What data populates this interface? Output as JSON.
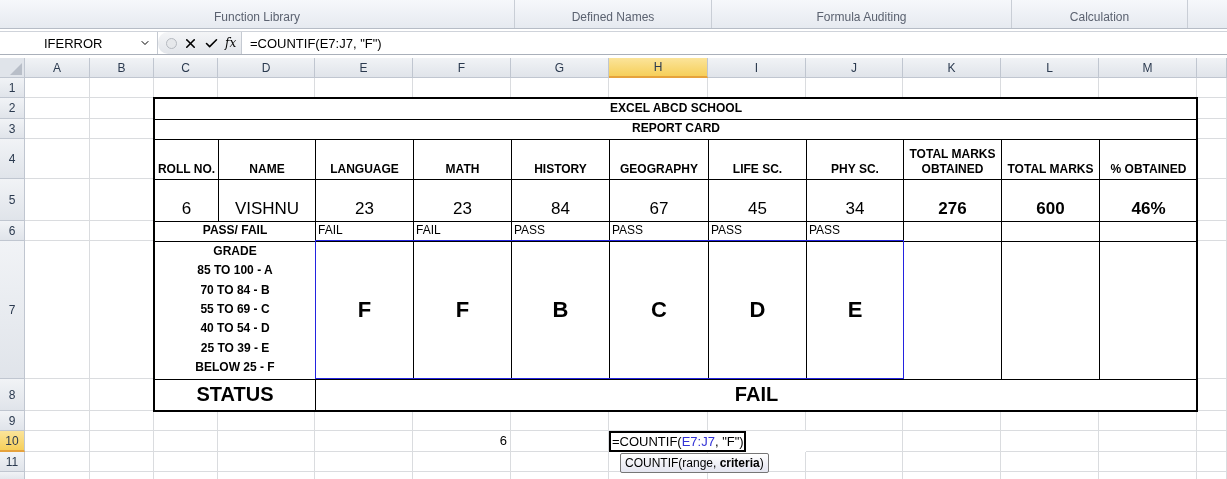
{
  "ribbon": {
    "groups": [
      {
        "label": "Function Library"
      },
      {
        "label": "Defined Names"
      },
      {
        "label": "Formula Auditing"
      },
      {
        "label": "Calculation"
      }
    ]
  },
  "formula_bar": {
    "name_box": "IFERROR",
    "fx": "fx",
    "formula": "=COUNTIF(E7:J7, \"F\")"
  },
  "columns": [
    {
      "label": "A",
      "selected": false
    },
    {
      "label": "B",
      "selected": false
    },
    {
      "label": "C",
      "selected": false
    },
    {
      "label": "D",
      "selected": false
    },
    {
      "label": "E",
      "selected": false
    },
    {
      "label": "F",
      "selected": false
    },
    {
      "label": "G",
      "selected": false
    },
    {
      "label": "H",
      "selected": true
    },
    {
      "label": "I",
      "selected": false
    },
    {
      "label": "J",
      "selected": false
    },
    {
      "label": "K",
      "selected": false
    },
    {
      "label": "L",
      "selected": false
    },
    {
      "label": "M",
      "selected": false
    }
  ],
  "rows": [
    {
      "label": "1",
      "selected": false
    },
    {
      "label": "2",
      "selected": false
    },
    {
      "label": "3",
      "selected": false
    },
    {
      "label": "4",
      "selected": false
    },
    {
      "label": "5",
      "selected": false
    },
    {
      "label": "6",
      "selected": false
    },
    {
      "label": "7",
      "selected": false
    },
    {
      "label": "8",
      "selected": false
    },
    {
      "label": "9",
      "selected": false
    },
    {
      "label": "10",
      "selected": true
    },
    {
      "label": "11",
      "selected": false
    }
  ],
  "report": {
    "title": "EXCEL ABCD SCHOOL",
    "subtitle": "REPORT CARD",
    "headers": [
      "ROLL NO.",
      "NAME",
      "LANGUAGE",
      "MATH",
      "HISTORY",
      "GEOGRAPHY",
      "LIFE SC.",
      "PHY SC.",
      "TOTAL MARKS OBTAINED",
      "TOTAL MARKS",
      "% OBTAINED"
    ],
    "values": [
      "6",
      "VISHNU",
      "23",
      "23",
      "84",
      "67",
      "45",
      "34",
      "276",
      "600",
      "46%"
    ],
    "pass_label": "PASS/ FAIL",
    "results": [
      "FAIL",
      "FAIL",
      "PASS",
      "PASS",
      "PASS",
      "PASS"
    ],
    "grade_legend": [
      "GRADE",
      "85 TO 100 - A",
      "70 TO 84 - B",
      "55 TO 69 - C",
      "40 TO 54 - D",
      "25 TO 39 - E",
      "BELOW 25 - F"
    ],
    "grades": [
      "F",
      "F",
      "B",
      "C",
      "D",
      "E"
    ],
    "status_label": "STATUS",
    "status": "FAIL"
  },
  "count_cell": "6",
  "editing_cell": {
    "prefix": "=COUNTIF(",
    "range": "E7:J7",
    "suffix": ", \"F\")"
  },
  "tooltip": "COUNTIF(range, **criteria**)"
}
